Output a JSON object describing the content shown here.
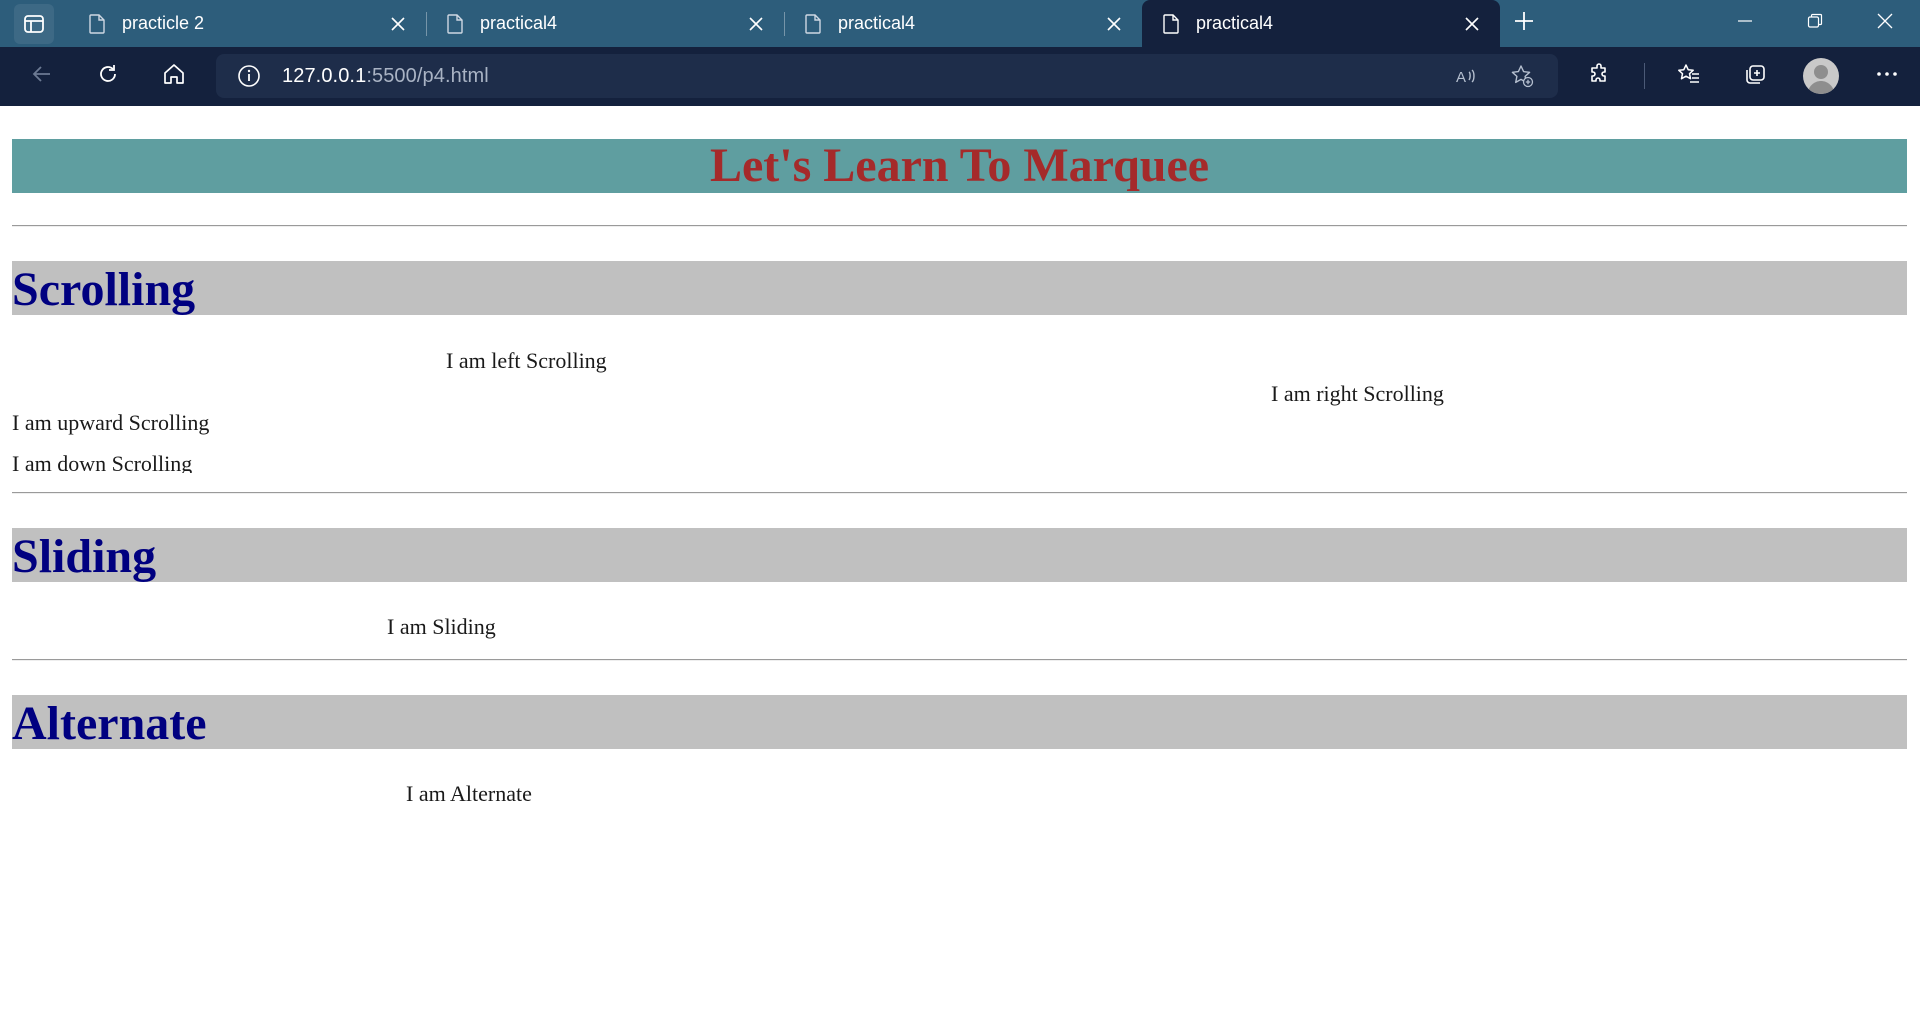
{
  "browser": {
    "tabs": [
      {
        "title": "practicle 2",
        "active": false
      },
      {
        "title": "practical4",
        "active": false
      },
      {
        "title": "practical4",
        "active": false
      },
      {
        "title": "practical4",
        "active": true
      }
    ],
    "address": {
      "host": "127.0.0.1",
      "rest": ":5500/p4.html"
    },
    "icons": {
      "tab_actions": "tab-actions-icon",
      "doc": "document-icon",
      "close": "close-icon",
      "new_tab": "plus-icon",
      "minimize": "minimize-icon",
      "restore": "restore-icon",
      "window_close": "close-icon",
      "back": "back-arrow-icon",
      "refresh": "refresh-icon",
      "home": "home-icon",
      "info": "info-icon",
      "read_aloud": "read-aloud-icon",
      "add_favorite": "add-favorite-icon",
      "extensions": "puzzle-icon",
      "favorites": "favorites-icon",
      "collections": "collections-icon",
      "profile": "profile-icon",
      "more": "more-icon"
    },
    "colors": {
      "tabstrip": "#2d5d7b",
      "toolbar": "#14213d"
    }
  },
  "page": {
    "banner_title": "Let's Learn To Marquee",
    "sections": {
      "scrolling": {
        "heading": "Scrolling",
        "left": "I am left Scrolling",
        "right": "I am right Scrolling",
        "up": "I am upward Scrolling",
        "down": "I am down Scrolling"
      },
      "sliding": {
        "heading": "Sliding",
        "text": "I am Sliding"
      },
      "alternate": {
        "heading": "Alternate",
        "text": "I am Alternate"
      }
    },
    "colors": {
      "banner_bg": "#5f9ea0",
      "banner_text": "#a52a2a",
      "heading_bg": "#c0c0c0",
      "heading_text": "#000080"
    }
  }
}
